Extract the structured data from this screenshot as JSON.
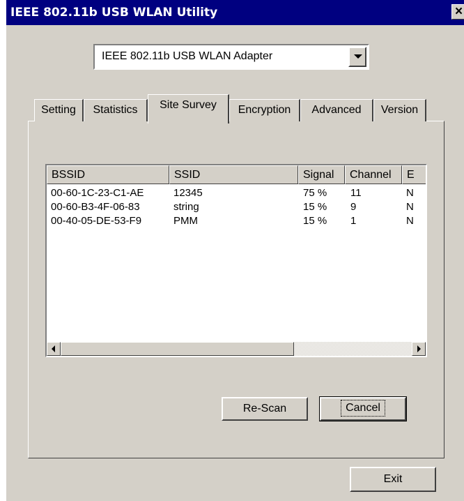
{
  "window": {
    "title": "IEEE 802.11b USB WLAN Utility",
    "close_glyph": "×"
  },
  "adapter_select": {
    "value": "IEEE 802.11b USB WLAN Adapter"
  },
  "tabs": [
    {
      "label": "Setting"
    },
    {
      "label": "Statistics"
    },
    {
      "label": "Site Survey",
      "active": true
    },
    {
      "label": "Encryption"
    },
    {
      "label": "Advanced"
    },
    {
      "label": "Version"
    }
  ],
  "site_survey": {
    "columns": [
      "BSSID",
      "SSID",
      "Signal",
      "Channel",
      "E"
    ],
    "rows": [
      {
        "bssid": "00-60-1C-23-C1-AE",
        "ssid": "12345",
        "signal": "75 %",
        "channel": "11",
        "e": "N"
      },
      {
        "bssid": "00-60-B3-4F-06-83",
        "ssid": "string",
        "signal": "15 %",
        "channel": "9",
        "e": "N"
      },
      {
        "bssid": "00-40-05-DE-53-F9",
        "ssid": "PMM",
        "signal": "15 %",
        "channel": "1",
        "e": "N"
      }
    ],
    "rescan_label": "Re-Scan",
    "cancel_label": "Cancel"
  },
  "exit_label": "Exit",
  "colors": {
    "face": "#d4d0c8",
    "title_bar": "#000080"
  }
}
